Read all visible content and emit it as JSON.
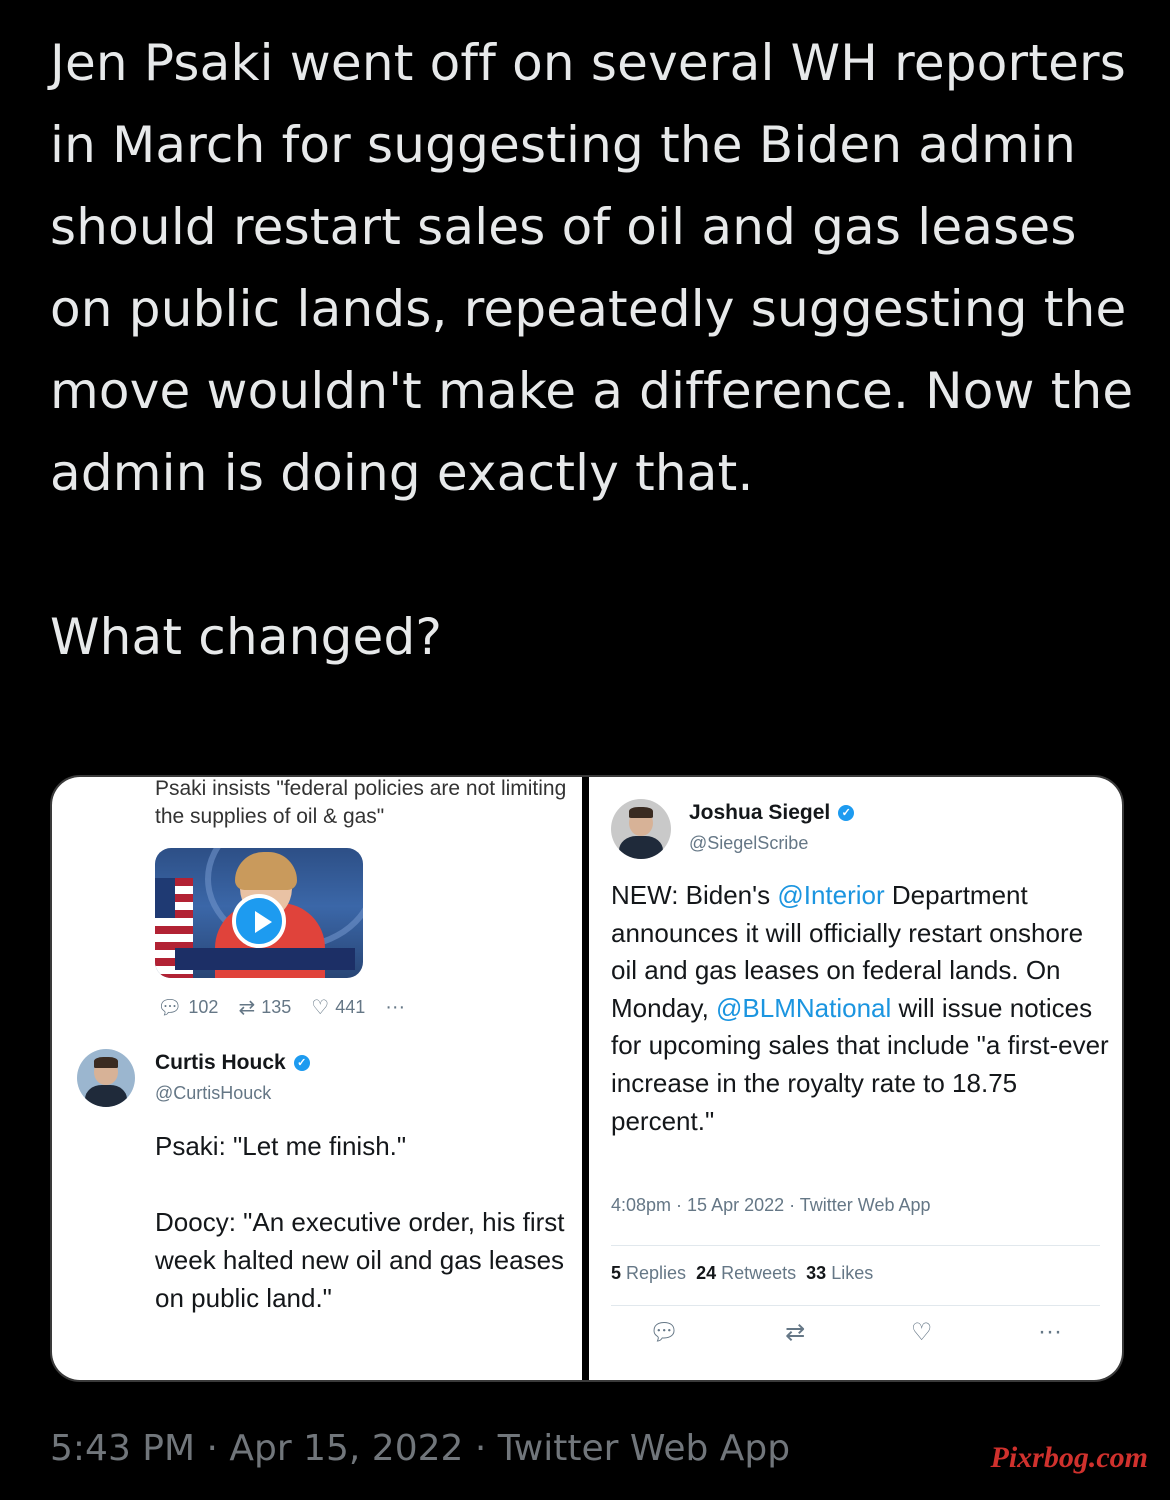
{
  "tweet": {
    "text": "Jen Psaki went off on several WH reporters in March for suggesting the Biden admin should restart sales of oil and gas leases on public lands, repeatedly suggesting the move wouldn't make a difference. Now the admin is doing exactly that.\n\nWhat changed?",
    "timestamp": "5:43 PM · Apr 15, 2022 · Twitter Web App"
  },
  "left_screenshot": {
    "top_text": "Psaki insists \"federal policies are not limiting the supplies of oil & gas\"",
    "video": {
      "play_icon": "play-icon"
    },
    "stats": {
      "replies": "102",
      "retweets": "135",
      "likes": "441"
    },
    "author": {
      "name": "Curtis Houck",
      "handle": "@CurtisHouck"
    },
    "body": "Psaki: \"Let me finish.\"\n\nDoocy: \"An executive order, his first week halted new oil and gas leases on public land.\""
  },
  "right_screenshot": {
    "author": {
      "name": "Joshua Siegel",
      "handle": "@SiegelScribe"
    },
    "body_parts": {
      "p1": "NEW: Biden's ",
      "m1": "@Interior",
      "p2": " Department announces it will officially restart onshore oil and gas leases on federal lands. On Monday, ",
      "m2": "@BLMNational",
      "p3": " will issue notices for upcoming sales that include \"a first-ever increase in the royalty rate to 18.75 percent.\""
    },
    "meta": "4:08pm · 15 Apr 2022 · Twitter Web App",
    "counts": {
      "replies_num": "5",
      "replies_label": "Replies",
      "retweets_num": "24",
      "retweets_label": "Retweets",
      "likes_num": "33",
      "likes_label": "Likes"
    }
  },
  "watermark": "Pixrbog.com",
  "colors": {
    "background": "#000000",
    "link": "#1b95e0",
    "verified": "#1d9bf0"
  }
}
